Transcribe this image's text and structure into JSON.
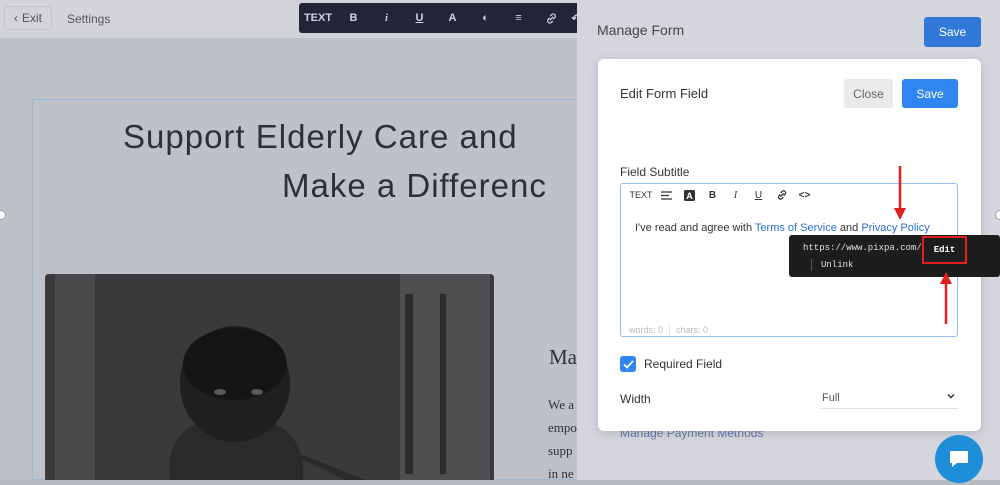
{
  "topbar": {
    "exit_label": "Exit",
    "settings_label": "Settings",
    "toolbar_text_label": "TEXT"
  },
  "page": {
    "heading_line1": "Support Elderly Care and",
    "heading_line2": "Make a Differenc",
    "subheading": "Ma",
    "paragraph_lines": [
      "We a",
      "empo",
      "supp",
      "in ne"
    ]
  },
  "panel": {
    "title": "Manage Form",
    "save_label": "Save",
    "link_text": "Manage Payment Methods"
  },
  "modal": {
    "title": "Edit Form Field",
    "close_label": "Close",
    "save_label": "Save",
    "field_subtitle_label": "Field Subtitle",
    "editor": {
      "toolbar_text_label": "TEXT",
      "text_before": "I've read and agree with ",
      "link1": "Terms of Service",
      "text_mid": " and ",
      "link2": "Privacy Policy",
      "words": "words: 0",
      "chars": "chars: 0"
    },
    "required_label": "Required Field",
    "required_checked": true,
    "width_label": "Width",
    "width_value": "Full"
  },
  "tooltip": {
    "url": "https://www.pixpa.com/",
    "edit_label": "Edit",
    "unlink_label": "Unlink"
  },
  "colors": {
    "primary_blue": "#2f86f0",
    "annotation_red": "#e02020",
    "toolbar_dark": "#232339"
  }
}
